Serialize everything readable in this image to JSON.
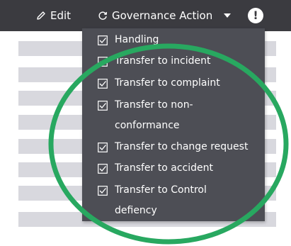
{
  "toolbar": {
    "edit_label": "Edit",
    "governance_label": "Governance Action",
    "alert_symbol": "!"
  },
  "menu": {
    "items": [
      {
        "label": "Handling",
        "icon": "checkbox-checked-icon"
      },
      {
        "label": "Transfer to incident",
        "icon": "checkbox-checked-icon"
      },
      {
        "label": "Transfer to complaint",
        "icon": "checkbox-checked-icon"
      },
      {
        "label": "Transfer to non-conformance",
        "icon": "checkbox-checked-icon"
      },
      {
        "label": "Transfer to change request",
        "icon": "checkbox-checked-icon"
      },
      {
        "label": "Transfer to accident",
        "icon": "checkbox-checked-icon"
      },
      {
        "label": "Transfer to Control defiency",
        "icon": "checkbox-checked-icon"
      }
    ]
  },
  "colors": {
    "toolbar_bg": "#3b3b40",
    "menu_bg": "#4d4e55",
    "menu_text": "#ffffff",
    "annotation": "#28a860",
    "row_bg": "#d8d8de"
  }
}
